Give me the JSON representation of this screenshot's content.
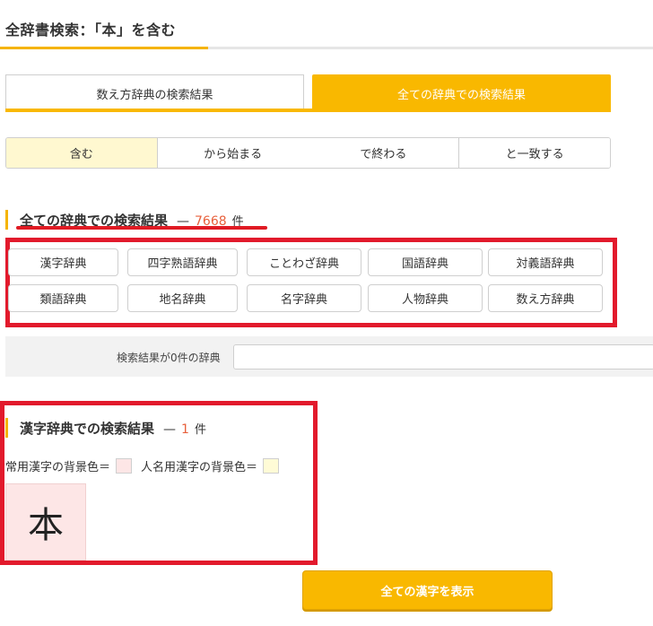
{
  "page": {
    "title": "全辞書検索：「本」を含む"
  },
  "tabs": [
    {
      "label": "数え方辞典の検索結果",
      "active": false
    },
    {
      "label": "全ての辞典での検索結果",
      "active": true
    }
  ],
  "modes": [
    {
      "label": "含む",
      "selected": true
    },
    {
      "label": "から始まる",
      "selected": false
    },
    {
      "label": "で終わる",
      "selected": false
    },
    {
      "label": "と一致する",
      "selected": false
    }
  ],
  "all_results": {
    "title": "全ての辞典での検索結果",
    "dash": "—",
    "count": "7668",
    "unit": "件"
  },
  "dictionaries": [
    "漢字辞典",
    "四字熟語辞典",
    "ことわざ辞典",
    "国語辞典",
    "対義語辞典",
    "類語辞典",
    "地名辞典",
    "名字辞典",
    "人物辞典",
    "数え方辞典"
  ],
  "zero_results": {
    "label": "検索結果が0件の辞典"
  },
  "kanji_results": {
    "title": "漢字辞典での検索結果",
    "dash": "—",
    "count": "1",
    "unit": "件",
    "legend_joyo": "常用漢字の背景色＝",
    "legend_jinmei": "人名用漢字の背景色＝",
    "kanji": "本"
  },
  "show_all_button": "全ての漢字を表示",
  "colors": {
    "accent": "#f9b800",
    "count": "#e8603c",
    "highlight_frame": "#e21a2c",
    "joyo_bg": "#fde6e6",
    "jinmei_bg": "#fffbd6"
  }
}
